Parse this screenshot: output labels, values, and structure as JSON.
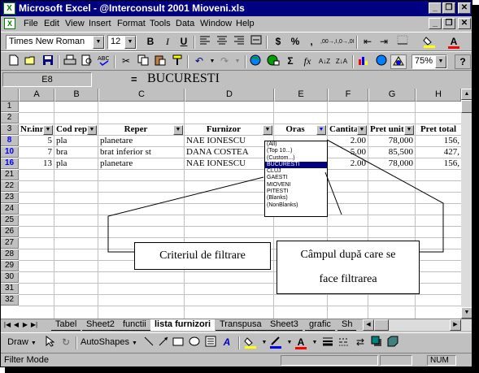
{
  "window": {
    "title": "Microsoft Excel - @Interconsult 2001 Mioveni.xls",
    "app_icon_letter": "X",
    "doc_icon_letter": "X",
    "minimize": "_",
    "restore": "❐",
    "close": "✕",
    "doc_minimize": "_",
    "doc_restore": "❐",
    "doc_close": "✕"
  },
  "menu": [
    "File",
    "Edit",
    "View",
    "Insert",
    "Format",
    "Tools",
    "Data",
    "Window",
    "Help"
  ],
  "formatting": {
    "font_name": "Times New Roman",
    "font_size": "12",
    "bold": "B",
    "italic": "I",
    "underline": "U",
    "currency": "$",
    "percent": "%",
    "comma": ",",
    "inc_decimal": ",00→,0",
    "dec_decimal": ",0→,00"
  },
  "standard": {
    "zoom": "75%",
    "sum": "Σ",
    "fx": "fx",
    "help": "?"
  },
  "formula_bar": {
    "name_box": "E8",
    "equals": "=",
    "value": "BUCURESTI"
  },
  "columns": [
    "A",
    "B",
    "C",
    "D",
    "E",
    "F",
    "G",
    "H"
  ],
  "rows": [
    "1",
    "2",
    "3",
    "8",
    "10",
    "16",
    "21",
    "22",
    "23",
    "24",
    "25",
    "26",
    "27",
    "28",
    "29",
    "30",
    "31",
    "32"
  ],
  "filtered_rows": [
    "8",
    "10",
    "16"
  ],
  "headers": [
    "Nr.inre",
    "Cod repe",
    "Reper",
    "Furnizor",
    "Oras",
    "Cantitat",
    "Pret unitar",
    "Pret total"
  ],
  "data_rows": [
    [
      "5",
      "pla",
      "planetare",
      "NAE IONESCU",
      "",
      "2.00",
      "78,000",
      "156,"
    ],
    [
      "7",
      "bra",
      "brat inferior st",
      "DANA COSTEA",
      "",
      "5.00",
      "85,500",
      "427,"
    ],
    [
      "13",
      "pla",
      "planetare",
      "NAE IONESCU",
      "",
      "2.00",
      "78,000",
      "156,"
    ]
  ],
  "autofilter": {
    "options": [
      "(All)",
      "(Top 10...)",
      "(Custom...)",
      "BUCURESTI",
      "CLUJ",
      "GAESTI",
      "MIOVENI",
      "PITESTI",
      "(Blanks)",
      "(NonBlanks)"
    ],
    "selected": "BUCURESTI"
  },
  "callouts": {
    "left": "Criteriul de filtrare",
    "right_line1": "Câmpul după care se",
    "right_line2": "face filtrarea"
  },
  "sheet_tabs": [
    "Tabel",
    "Sheet2",
    "functii",
    "lista furnizori",
    "Transpusa",
    "Sheet3",
    "grafic",
    "Sh"
  ],
  "active_tab": "lista furnizori",
  "drawing": {
    "draw_label": "Draw",
    "autoshapes_label": "AutoShapes"
  },
  "status": {
    "mode": "Filter Mode",
    "num": "NUM"
  },
  "colors": {
    "title_bar": "#000080",
    "filtered_row_number": "#0000ff",
    "selected_option": "#000080"
  }
}
